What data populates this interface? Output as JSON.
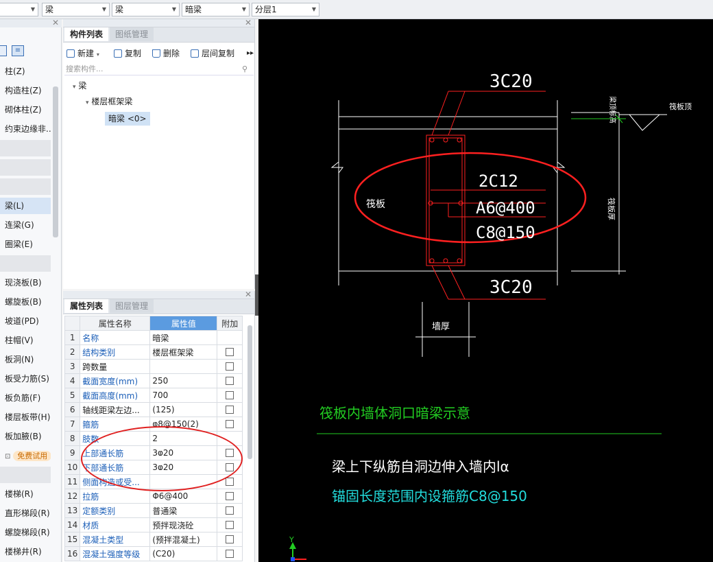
{
  "toolbar": {
    "dropdowns": [
      "",
      "梁",
      "梁",
      "暗梁",
      "分层1"
    ]
  },
  "left_nav": {
    "items": [
      {
        "label": "柱(Z)",
        "type": "item"
      },
      {
        "label": "构造柱(Z)",
        "type": "item"
      },
      {
        "label": "砌体柱(Z)",
        "type": "item"
      },
      {
        "label": "约束边缘非...",
        "type": "item"
      },
      {
        "label": "",
        "type": "bar"
      },
      {
        "label": "",
        "type": "bar"
      },
      {
        "label": "",
        "type": "bar"
      },
      {
        "label": "梁(L)",
        "type": "selected"
      },
      {
        "label": "连梁(G)",
        "type": "item"
      },
      {
        "label": "圈梁(E)",
        "type": "item"
      },
      {
        "label": "",
        "type": "bar"
      },
      {
        "label": "现浇板(B)",
        "type": "item"
      },
      {
        "label": "螺旋板(B)",
        "type": "item"
      },
      {
        "label": "坡道(PD)",
        "type": "item"
      },
      {
        "label": "柱帽(V)",
        "type": "item"
      },
      {
        "label": "板洞(N)",
        "type": "item"
      },
      {
        "label": "板受力筋(S)",
        "type": "item"
      },
      {
        "label": "板负筋(F)",
        "type": "item"
      },
      {
        "label": "楼层板带(H)",
        "type": "item"
      },
      {
        "label": "板加腋(B)",
        "type": "item"
      },
      {
        "label": "免费试用",
        "type": "trial"
      },
      {
        "label": "",
        "type": "bar"
      },
      {
        "label": "楼梯(R)",
        "type": "item"
      },
      {
        "label": "直形梯段(R)",
        "type": "item"
      },
      {
        "label": "螺旋梯段(R)",
        "type": "item"
      },
      {
        "label": "楼梯井(R)",
        "type": "item"
      }
    ]
  },
  "component_panel": {
    "tabs": [
      "构件列表",
      "图纸管理"
    ],
    "buttons": [
      "新建",
      "复制",
      "删除",
      "层间复制"
    ],
    "search_placeholder": "搜索构件...",
    "tree": {
      "root": "梁",
      "child": "楼层框架梁",
      "leaf": "暗梁 <0>"
    }
  },
  "property_panel": {
    "tabs": [
      "属性列表",
      "图层管理"
    ],
    "headers": [
      "属性名称",
      "属性值",
      "附加"
    ],
    "rows": [
      {
        "n": "1",
        "name": "名称",
        "value": "暗梁",
        "blue": true,
        "check": false
      },
      {
        "n": "2",
        "name": "结构类别",
        "value": "楼层框架梁",
        "blue": true,
        "check": true
      },
      {
        "n": "3",
        "name": "跨数量",
        "value": "",
        "blue": false,
        "check": true
      },
      {
        "n": "4",
        "name": "截面宽度(mm)",
        "value": "250",
        "blue": true,
        "check": true
      },
      {
        "n": "5",
        "name": "截面高度(mm)",
        "value": "700",
        "blue": true,
        "check": true
      },
      {
        "n": "6",
        "name": "轴线距梁左边...",
        "value": "(125)",
        "blue": false,
        "check": true
      },
      {
        "n": "7",
        "name": "箍筋",
        "value": "ⱷ8@150(2)",
        "blue": true,
        "check": true
      },
      {
        "n": "8",
        "name": "肢数",
        "value": "2",
        "blue": true,
        "check": false
      },
      {
        "n": "9",
        "name": "上部通长筋",
        "value": "3ⱷ20",
        "blue": true,
        "check": true
      },
      {
        "n": "10",
        "name": "下部通长筋",
        "value": "3ⱷ20",
        "blue": true,
        "check": true
      },
      {
        "n": "11",
        "name": "侧面构造或受...",
        "value": "",
        "blue": true,
        "check": true
      },
      {
        "n": "12",
        "name": "拉筋",
        "value": "Φ6@400",
        "blue": true,
        "check": true
      },
      {
        "n": "13",
        "name": "定额类别",
        "value": "普通梁",
        "blue": true,
        "check": true
      },
      {
        "n": "14",
        "name": "材质",
        "value": "预拌现浇砼",
        "blue": true,
        "check": true
      },
      {
        "n": "15",
        "name": "混凝土类型",
        "value": "(预拌混凝土)",
        "blue": true,
        "check": true
      },
      {
        "n": "16",
        "name": "混凝土强度等级",
        "value": "(C20)",
        "blue": true,
        "check": true
      }
    ]
  },
  "cad": {
    "top_rebar": "3C20",
    "bottom_rebar": "3C20",
    "rebar_2c12": "2C12",
    "rebar_a6": "A6@400",
    "rebar_c8": "C8@150",
    "raft_label": "筏板",
    "wall_thickness": "墙厚",
    "raft_top": "筏板顶",
    "elev_label": "梁顶标高",
    "raft_thickness": "筏板厚",
    "title": "筏板内墙体洞口暗梁示意",
    "note1": "梁上下纵筋自洞边伸入墙内lα",
    "note2": "锚固长度范围内设箍筋C8@150",
    "axis_y": "Y",
    "colors": {
      "red": "#ff2020",
      "white": "#ffffff",
      "green": "#22cc22",
      "cyan": "#22dddd",
      "accent_blue": "#5b9be0"
    }
  }
}
